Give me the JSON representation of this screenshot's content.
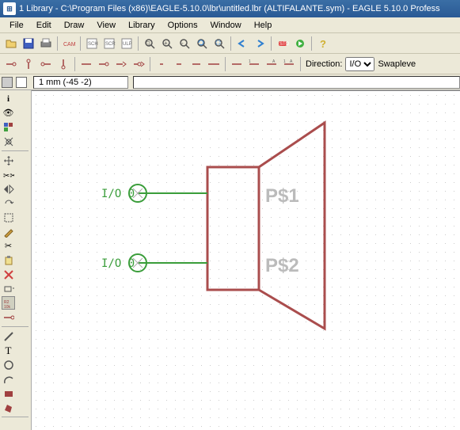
{
  "titlebar": {
    "title": "1 Library - C:\\Program Files (x86)\\EAGLE-5.10.0\\lbr\\untitled.lbr (ALTIFALANTE.sym) - EAGLE 5.10.0 Profess"
  },
  "menu": {
    "file": "File",
    "edit": "Edit",
    "draw": "Draw",
    "view": "View",
    "library": "Library",
    "options": "Options",
    "window": "Window",
    "help": "Help"
  },
  "toolbar2": {
    "direction_label": "Direction:",
    "direction_value": "I/O",
    "swap_label": "Swapleve"
  },
  "status": {
    "coords": "1 mm (-45 -2)",
    "cmd": ""
  },
  "canvas": {
    "pins": [
      {
        "label": "I/O 0",
        "name": "P$1"
      },
      {
        "label": "I/O 0",
        "name": "P$2"
      }
    ]
  }
}
